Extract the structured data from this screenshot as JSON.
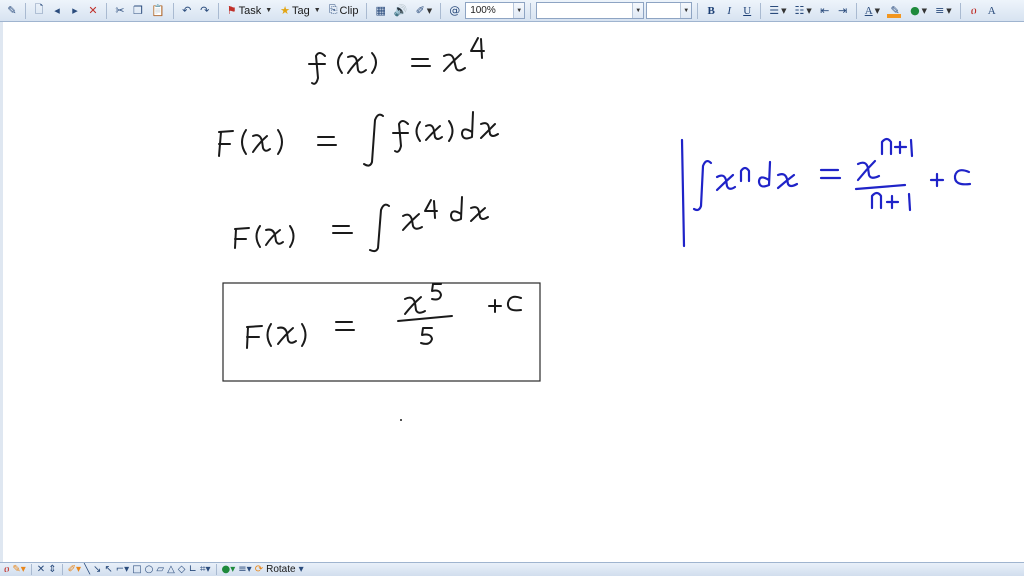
{
  "toolbar": {
    "task_label": "Task",
    "tag_label": "Tag",
    "clip_label": "Clip",
    "zoom_value": "100%",
    "font_name_value": "",
    "font_size_value": "",
    "bold_label": "B",
    "italic_label": "I",
    "underline_label": "U",
    "text_color_label": "A"
  },
  "bottombar": {
    "rotate_label": "Rotate"
  },
  "colors": {
    "ink_black": "#1a1a1a",
    "ink_blue": "#1f23c8",
    "highlight_orange": "#f2961f"
  },
  "icons": [
    "pen-icon",
    "new-page-icon",
    "prev-page-icon",
    "next-page-icon",
    "delete-page-icon",
    "cut-icon",
    "copy-icon",
    "paste-icon",
    "undo-icon",
    "redo-icon",
    "task-flag-icon",
    "tag-star-icon",
    "clip-icon",
    "table-icon",
    "audio-icon",
    "brush-icon",
    "insert-symbol-icon",
    "bullet-list-icon",
    "number-list-icon",
    "outdent-icon",
    "indent-icon",
    "font-color-icon",
    "highlight-icon",
    "fill-color-icon",
    "line-style-icon",
    "lasso-icon",
    "text-tool-icon",
    "eraser-icon",
    "arrow-tool-icon",
    "rectangle-icon",
    "ellipse-icon",
    "triangle-icon",
    "diamond-icon",
    "rotate-icon"
  ]
}
